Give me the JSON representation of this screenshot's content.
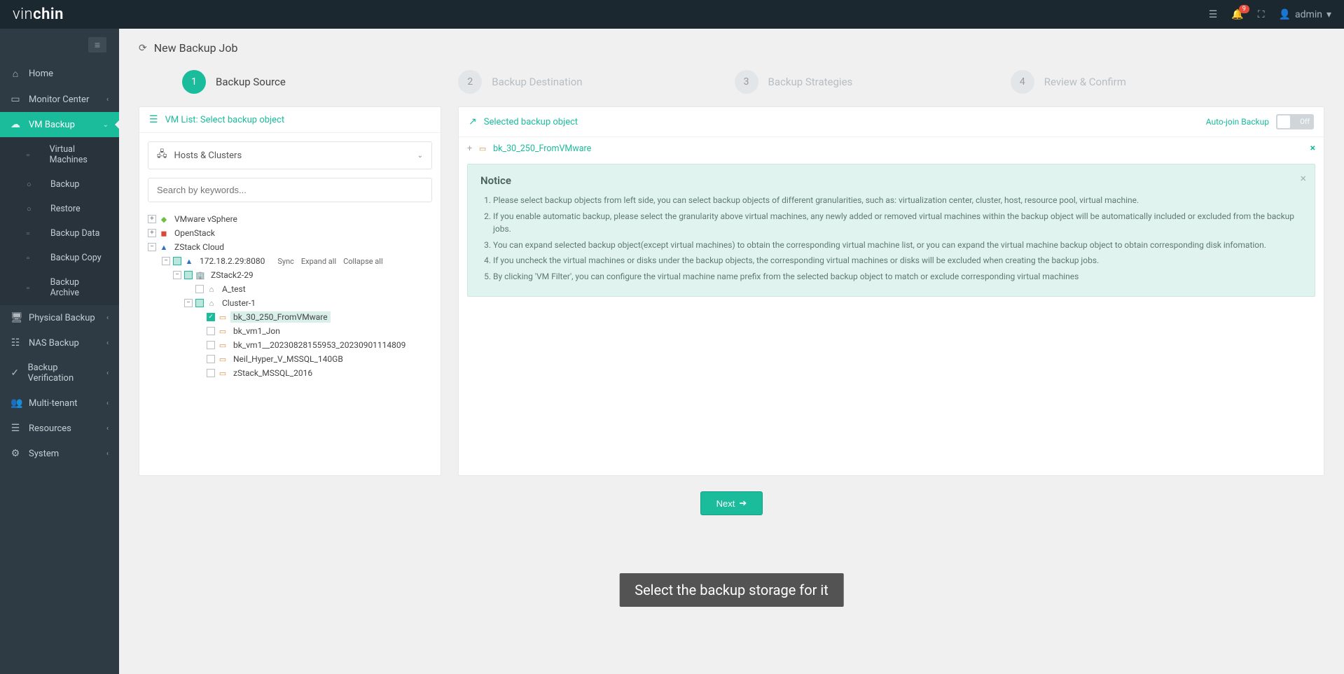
{
  "brand": {
    "part1": "vin",
    "part2": "chin"
  },
  "topbar": {
    "user": "admin",
    "notif_count": "9"
  },
  "sidebar": {
    "items": [
      {
        "label": "Home",
        "icon": "home"
      },
      {
        "label": "Monitor Center",
        "icon": "monitor",
        "expandable": true
      },
      {
        "label": "VM Backup",
        "icon": "vm",
        "expandable": true,
        "active": true
      },
      {
        "label": "Physical Backup",
        "icon": "physical",
        "expandable": true
      },
      {
        "label": "NAS Backup",
        "icon": "nas",
        "expandable": true
      },
      {
        "label": "Backup Verification",
        "icon": "verify",
        "expandable": true
      },
      {
        "label": "Multi-tenant",
        "icon": "tenant",
        "expandable": true
      },
      {
        "label": "Resources",
        "icon": "resources",
        "expandable": true
      },
      {
        "label": "System",
        "icon": "system",
        "expandable": true
      }
    ],
    "vm_sub": [
      {
        "label": "Virtual Machines"
      },
      {
        "label": "Backup"
      },
      {
        "label": "Restore"
      },
      {
        "label": "Backup Data"
      },
      {
        "label": "Backup Copy"
      },
      {
        "label": "Backup Archive"
      }
    ]
  },
  "page": {
    "title": "New Backup Job"
  },
  "wizard": {
    "steps": [
      {
        "num": "1",
        "label": "Backup Source"
      },
      {
        "num": "2",
        "label": "Backup Destination"
      },
      {
        "num": "3",
        "label": "Backup Strategies"
      },
      {
        "num": "4",
        "label": "Review & Confirm"
      }
    ]
  },
  "left_panel": {
    "title": "VM List: Select backup object",
    "scope": "Hosts & Clusters",
    "search_placeholder": "Search by keywords...",
    "tree": {
      "vmware": "VMware vSphere",
      "openstack": "OpenStack",
      "zstack": "ZStack Cloud",
      "ip_node": "172.18.2.29:8080",
      "actions": {
        "sync": "Sync",
        "expand": "Expand all",
        "collapse": "Collapse all"
      },
      "host1": "ZStack2-29",
      "a_test": "A_test",
      "cluster1": "Cluster-1",
      "vms": [
        "bk_30_250_FromVMware",
        "bk_vm1_Jon",
        "bk_vm1__20230828155953_20230901114809",
        "Neil_Hyper_V_MSSQL_140GB",
        "zStack_MSSQL_2016"
      ]
    }
  },
  "right_panel": {
    "title": "Selected backup object",
    "autojoin_label": "Auto-join Backup",
    "autojoin_state": "Off",
    "selected_vm": "bk_30_250_FromVMware",
    "notice": {
      "title": "Notice",
      "items": [
        "Please select backup objects from left side, you can select backup objects of different granularities, such as: virtualization center, cluster, host, resource pool, virtual machine.",
        "If you enable automatic backup, please select the granularity above virtual machines, any newly added or removed virtual machines within the backup object will be automatically included or excluded from the backup jobs.",
        "You can expand selected backup object(except virtual machines) to obtain the corresponding virtual machine list, or you can expand the virtual machine backup object to obtain corresponding disk infomation.",
        "If you uncheck the virtual machines or disks under the backup objects, the corresponding virtual machines or disks will be excluded when creating the backup jobs.",
        "By clicking 'VM Filter', you can configure the virtual machine name prefix from the selected backup object to match or exclude corresponding virtual machines"
      ]
    }
  },
  "footer": {
    "next": "Next"
  },
  "overlay": {
    "caption": "Select the backup storage for it"
  }
}
